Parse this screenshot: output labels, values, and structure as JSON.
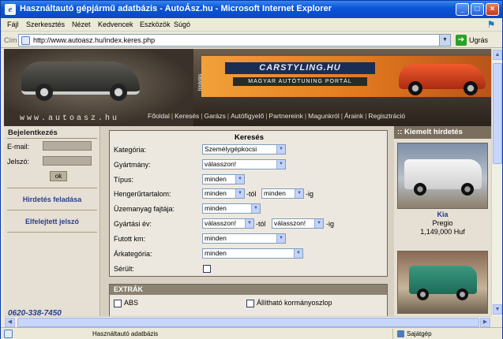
{
  "window": {
    "title": "Használtautó gépjármű adatbázis - AutoÁsz.hu - Microsoft Internet Explorer"
  },
  "menu": [
    "Fájl",
    "Szerkesztés",
    "Nézet",
    "Kedvencek",
    "Eszközök",
    "Súgó"
  ],
  "address": {
    "label": "Cím",
    "url": "http://www.autoasz.hu/index.keres.php",
    "go": "Ugrás"
  },
  "header": {
    "site": "www.autoasz.hu",
    "banner_name": "CARSTYLING.HU",
    "banner_sub": "MAGYAR AUTÓTUNING PORTÁL",
    "banner_side": "hirdetés"
  },
  "nav": [
    "Főoldal",
    "Keresés",
    "Garázs",
    "Autófigyelő",
    "Partnereink",
    "Magunkról",
    "Áraink",
    "Regisztráció"
  ],
  "login": {
    "title": "Bejelentkezés",
    "email_label": "E-mail:",
    "password_label": "Jelszó:",
    "ok": "ok",
    "email": "",
    "password": ""
  },
  "left_links": {
    "post_ad": "Hirdetés feladása",
    "forgot": "Elfelejtett jelszó",
    "phone": "0620-338-7450"
  },
  "search": {
    "title": "Keresés",
    "category": {
      "label": "Kategória:",
      "value": "Személygépkocsi"
    },
    "make": {
      "label": "Gyártmány:",
      "value": "válasszon!"
    },
    "model": {
      "label": "Típus:",
      "value": "minden"
    },
    "engine": {
      "label": "Hengerűrtartalom:",
      "from": "minden",
      "to": "minden",
      "from_suffix": "-tól",
      "to_suffix": "-ig"
    },
    "fuel": {
      "label": "Üzemanyag fajtája:",
      "value": "minden"
    },
    "year": {
      "label": "Gyártási év:",
      "from": "válasszon!",
      "to": "válasszon!",
      "from_suffix": "-tól",
      "to_suffix": "-ig"
    },
    "km": {
      "label": "Futott km:",
      "value": "minden"
    },
    "price": {
      "label": "Árkategória:",
      "value": "minden"
    },
    "damaged": {
      "label": "Sérült:",
      "checked": false
    }
  },
  "extras": {
    "title": "EXTRÁK",
    "items": [
      "ABS",
      "Állítható kormányoszlop"
    ]
  },
  "featured": {
    "title": ":: Kiemelt hirdetés",
    "ad": {
      "make": "Kia",
      "model": "Pregio",
      "price": "1,149,000 Huf"
    }
  },
  "status": {
    "text": "Használtautó adatbázis",
    "zone": "Sajátgép"
  }
}
